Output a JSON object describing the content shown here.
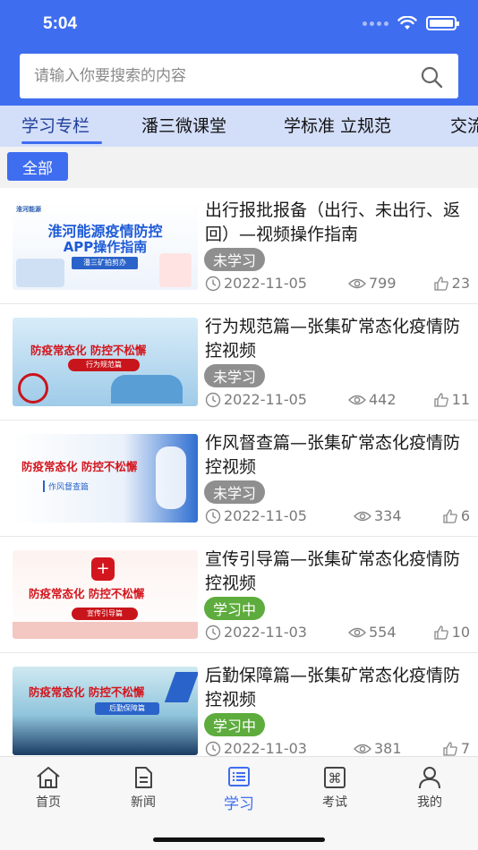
{
  "status_bar": {
    "time": "5:04"
  },
  "search": {
    "placeholder": "请输入你要搜索的内容"
  },
  "tabs": [
    {
      "label": "学习专栏",
      "active": true
    },
    {
      "label": "潘三微课堂"
    },
    {
      "label": "学标准 立规范"
    },
    {
      "label": "交流"
    }
  ],
  "filter": {
    "label": "全部"
  },
  "items": [
    {
      "title": "出行报批报备（出行、未出行、返回）—视频操作指南",
      "status": "未学习",
      "date": "2022-11-05",
      "views": "799",
      "likes": "23",
      "thumb": {
        "logo": "淮河能源",
        "line1": "淮河能源疫情防控",
        "line2": "APP操作指南",
        "sub": "潘三矿拍剪办"
      }
    },
    {
      "title": "行为规范篇—张集矿常态化疫情防控视频",
      "status": "未学习",
      "date": "2022-11-05",
      "views": "442",
      "likes": "11",
      "thumb": {
        "line1": "防疫常态化 防控不松懈",
        "sub": "行为规范篇"
      }
    },
    {
      "title": "作风督查篇—张集矿常态化疫情防控视频",
      "status": "未学习",
      "date": "2022-11-05",
      "views": "334",
      "likes": "6",
      "thumb": {
        "line1": "防疫常态化 防控不松懈",
        "sub": "作风督查篇"
      }
    },
    {
      "title": "宣传引导篇—张集矿常态化疫情防控视频",
      "status": "学习中",
      "date": "2022-11-03",
      "views": "554",
      "likes": "10",
      "thumb": {
        "line1": "防疫常态化 防控不松懈",
        "sub": "宣传引导篇"
      }
    },
    {
      "title": "后勤保障篇—张集矿常态化疫情防控视频",
      "status": "学习中",
      "date": "2022-11-03",
      "views": "381",
      "likes": "7",
      "thumb": {
        "line1": "防疫常态化 防控不松懈",
        "sub": "后勤保障篇"
      }
    }
  ],
  "bottom_nav": [
    {
      "label": "首页",
      "icon": "home-icon"
    },
    {
      "label": "新闻",
      "icon": "news-icon"
    },
    {
      "label": "学习",
      "icon": "study-icon",
      "active": true
    },
    {
      "label": "考试",
      "icon": "exam-icon"
    },
    {
      "label": "我的",
      "icon": "profile-icon"
    }
  ],
  "colors": {
    "brand": "#3f6df0",
    "tab_bg": "#d3def9",
    "badge_unlearned": "#8f8f8f",
    "badge_learning": "#5dac3d"
  }
}
